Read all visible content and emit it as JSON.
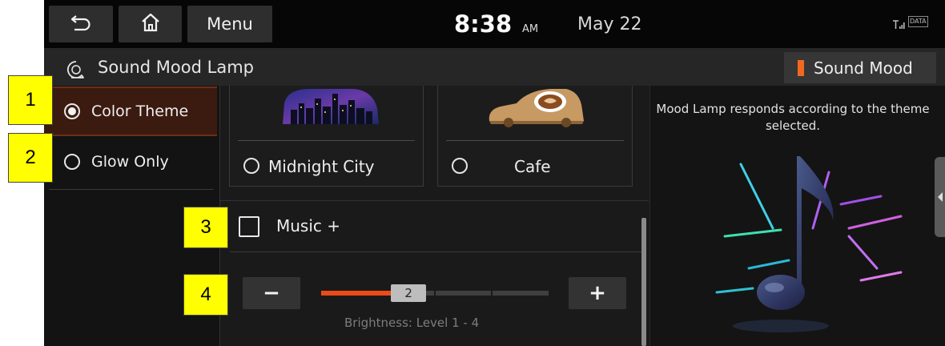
{
  "status_bar": {
    "menu_label": "Menu",
    "time": "8:38",
    "ampm": "AM",
    "date": "May 22",
    "data_indicator": "DATA"
  },
  "title_bar": {
    "title": "Sound Mood Lamp",
    "mode_button_label": "Sound Mood",
    "mode_indicator_color": "#f06a1e"
  },
  "options": [
    {
      "label": "Color Theme",
      "selected": true
    },
    {
      "label": "Glow Only",
      "selected": false
    }
  ],
  "themes": [
    {
      "label": "Midnight City",
      "selected": false
    },
    {
      "label": "Cafe",
      "selected": false
    }
  ],
  "music_plus": {
    "label": "Music +",
    "checked": false
  },
  "brightness": {
    "minus_label": "−",
    "plus_label": "+",
    "value": "2",
    "level": 2,
    "max_level": 4,
    "caption": "Brightness: Level 1 - 4",
    "accent_color": "#ec4a16"
  },
  "description": "Mood Lamp responds according to the theme selected.",
  "callouts": [
    "1",
    "2",
    "3",
    "4"
  ],
  "icons": {
    "back": "back-arrow-icon",
    "home": "home-icon",
    "title": "mood-lamp-icon",
    "signal": "signal-icon",
    "music": "music-note-icon"
  }
}
